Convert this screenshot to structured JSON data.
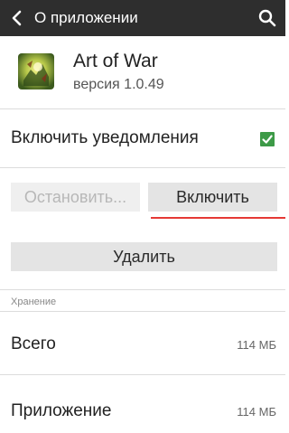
{
  "topbar": {
    "title": "О приложении",
    "back_icon": "chevron-left-icon",
    "search_icon": "search-icon",
    "background": "#2e2e2e"
  },
  "app": {
    "name": "Art of War",
    "version": "версия 1.0.49",
    "icon": "app-icon"
  },
  "notifications": {
    "label": "Включить уведомления",
    "checked": true,
    "check_color": "#3d9a47"
  },
  "actions": {
    "stop_label": "Остановить...",
    "stop_enabled": false,
    "enable_label": "Включить",
    "delete_label": "Удалить",
    "highlight_color": "#e53935"
  },
  "storage": {
    "header": "Хранение",
    "rows": [
      {
        "label": "Всего",
        "value": "114 МБ"
      },
      {
        "label": "Приложение",
        "value": "114 МБ"
      }
    ]
  }
}
